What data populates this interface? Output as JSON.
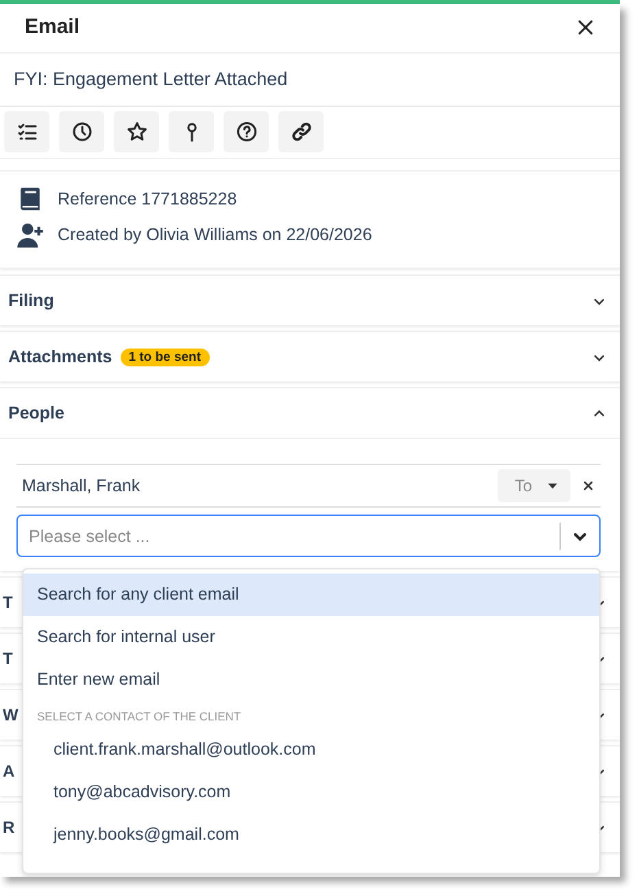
{
  "panel": {
    "title": "Email",
    "subject": "FYI: Engagement Letter Attached"
  },
  "info": [
    {
      "text": "Reference 1771885228"
    },
    {
      "text": "Created by Olivia Williams on 22/06/2026"
    }
  ],
  "sections": [
    {
      "title": "Filing",
      "expanded": false
    },
    {
      "title": "Attachments",
      "expanded": false,
      "badge": "1 to be sent"
    },
    {
      "title": "People",
      "expanded": true,
      "recipients": [
        {
          "name": "Marshall, Frank",
          "type": "To"
        }
      ],
      "select": {
        "placeholder": "Please select ..."
      }
    },
    {
      "title": "T",
      "expanded": false
    },
    {
      "title": "T",
      "expanded": false
    },
    {
      "title": "W",
      "expanded": false
    },
    {
      "title": "A",
      "expanded": false
    },
    {
      "title": "R",
      "expanded": false
    }
  ],
  "dropdown": [
    {
      "kind": "option",
      "text": "Search for any client email",
      "selected": true
    },
    {
      "kind": "option",
      "text": "Search for internal user",
      "selected": false
    },
    {
      "kind": "option",
      "text": "Enter new email",
      "selected": false
    },
    {
      "kind": "group",
      "text": "SELECT A CONTACT OF THE CLIENT"
    },
    {
      "kind": "contact",
      "text": "client.frank.marshall@outlook.com",
      "selected": false
    },
    {
      "kind": "contact",
      "text": "tony@abcadvisory.com",
      "selected": false
    },
    {
      "kind": "contact",
      "text": "jenny.books@gmail.com",
      "selected": false
    }
  ]
}
